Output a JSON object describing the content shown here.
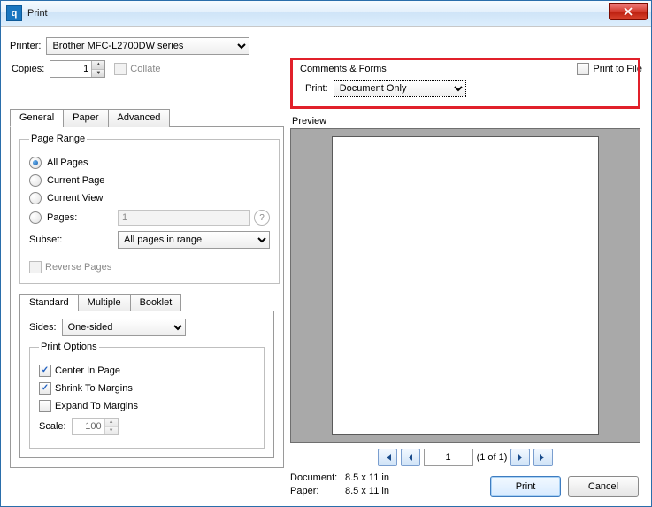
{
  "window": {
    "title": "Print"
  },
  "printer": {
    "label": "Printer:",
    "selected": "Brother MFC-L2700DW series",
    "copies_label": "Copies:",
    "copies_value": "1",
    "collate_label": "Collate",
    "print_to_file_label": "Print to File"
  },
  "tabs_main": {
    "general": "General",
    "paper": "Paper",
    "advanced": "Advanced"
  },
  "page_range": {
    "legend": "Page Range",
    "all": "All Pages",
    "current_page": "Current Page",
    "current_view": "Current View",
    "pages": "Pages:",
    "pages_value": "1",
    "subset_label": "Subset:",
    "subset_value": "All pages in range",
    "reverse": "Reverse Pages"
  },
  "tabs_layout": {
    "standard": "Standard",
    "multiple": "Multiple",
    "booklet": "Booklet"
  },
  "sides": {
    "label": "Sides:",
    "value": "One-sided"
  },
  "print_options": {
    "legend": "Print Options",
    "center": "Center In Page",
    "shrink": "Shrink To Margins",
    "expand": "Expand To Margins",
    "scale_label": "Scale:",
    "scale_value": "100"
  },
  "comments_forms": {
    "legend": "Comments & Forms",
    "print_label": "Print:",
    "print_value": "Document Only"
  },
  "preview": {
    "label": "Preview",
    "page_number": "1",
    "page_of": "(1 of 1)",
    "doc_label": "Document:",
    "doc_size": "8.5 x 11 in",
    "paper_label": "Paper:",
    "paper_size": "8.5 x 11 in"
  },
  "buttons": {
    "print": "Print",
    "cancel": "Cancel"
  }
}
